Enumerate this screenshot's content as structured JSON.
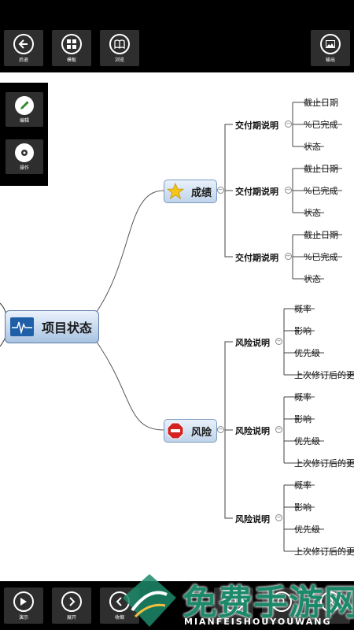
{
  "toolbar_top": {
    "back_label": "后退",
    "template_label": "模板",
    "browse_label": "浏览",
    "export_label": "输出"
  },
  "side_panel": {
    "edit_label": "编辑",
    "action_label": "操作"
  },
  "toolbar_bottom": {
    "present_label": "演示",
    "expand_label": "展开",
    "collapse_label": "收缩"
  },
  "mindmap": {
    "root": "项目状态",
    "branch_1": {
      "label": "成绩",
      "children": [
        {
          "label": "交付期说明",
          "leaves": [
            "截止日期",
            "%已完成",
            "状态"
          ]
        },
        {
          "label": "交付期说明",
          "leaves": [
            "截止日期",
            "%已完成",
            "状态"
          ]
        },
        {
          "label": "交付期说明",
          "leaves": [
            "截止日期",
            "%已完成",
            "状态"
          ]
        }
      ]
    },
    "branch_2": {
      "label": "风险",
      "children": [
        {
          "label": "风险说明",
          "leaves": [
            "概率",
            "影响",
            "优先级",
            "上次修订后的更"
          ]
        },
        {
          "label": "风险说明",
          "leaves": [
            "概率",
            "影响",
            "优先级",
            "上次修订后的更"
          ]
        },
        {
          "label": "风险说明",
          "leaves": [
            "概率",
            "影响",
            "优先级",
            "上次修订后的更"
          ]
        }
      ]
    }
  },
  "watermark": {
    "title": "免费手游网",
    "subtitle": "MIANFEISHOUYOUWANG"
  },
  "colors": {
    "bar_bg": "#000000",
    "button_bg": "#2e2e2e",
    "node_border": "#7a9ac0",
    "star": "#f5c518",
    "stop": "#d32222",
    "watermark_green": "#1c8a6a"
  }
}
